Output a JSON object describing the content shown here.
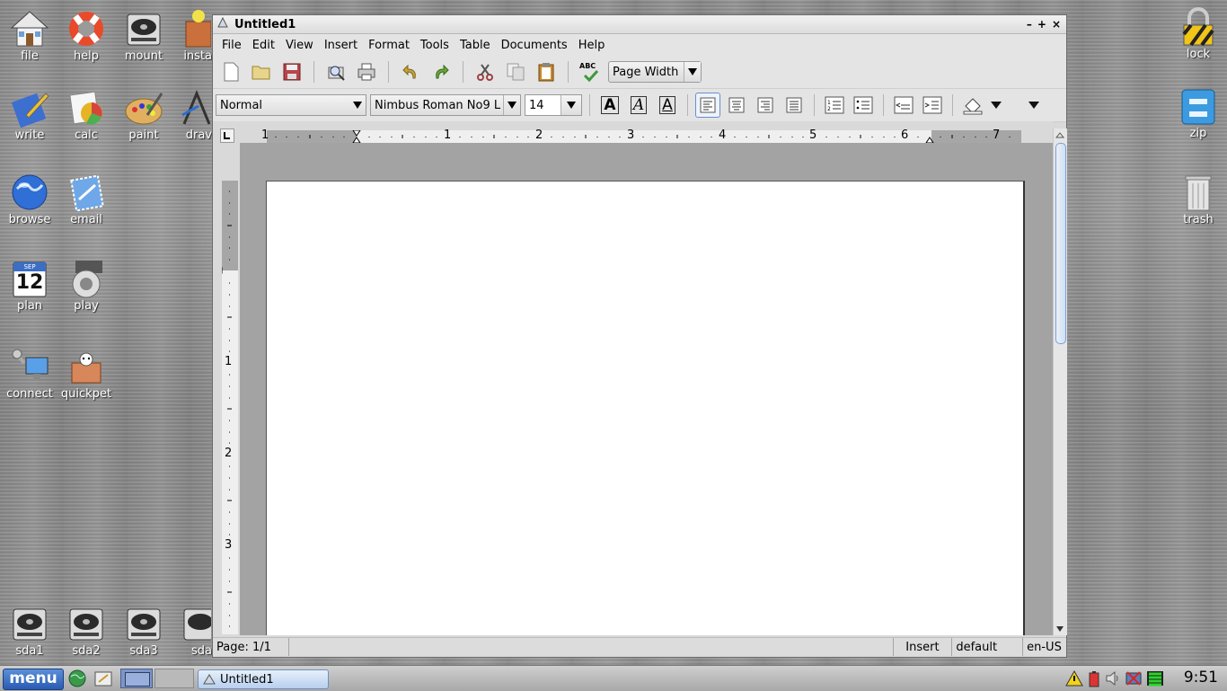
{
  "desktop_icons": {
    "file": "file",
    "help": "help",
    "mount": "mount",
    "install": "insta",
    "write": "write",
    "calc": "calc",
    "paint": "paint",
    "draw": "drav",
    "browse": "browse",
    "email": "email",
    "plan": "plan",
    "plan_date": "12",
    "plan_month": "SEP",
    "play": "play",
    "connect": "connect",
    "quickpet": "quickpet",
    "sda1": "sda1",
    "sda2": "sda2",
    "sda3": "sda3",
    "sda4": "sda",
    "lock": "lock",
    "zip": "zip",
    "trash": "trash"
  },
  "window": {
    "title": "Untitled1",
    "controls": {
      "minimize": "–",
      "maximize": "+",
      "close": "×"
    }
  },
  "menu": [
    "File",
    "Edit",
    "View",
    "Insert",
    "Format",
    "Tools",
    "Table",
    "Documents",
    "Help"
  ],
  "toolbar": {
    "zoom": "Page Width",
    "spell_label": "ABC"
  },
  "format_bar": {
    "style": "Normal",
    "font": "Nimbus Roman No9 L",
    "size": "14",
    "bold": "A",
    "italic": "A",
    "underline": "A"
  },
  "ruler": {
    "h_numbers": [
      "1",
      "1",
      "2",
      "3",
      "4",
      "5",
      "6",
      "7"
    ],
    "v_numbers": [
      "1",
      "2",
      "3"
    ]
  },
  "status": {
    "page": "Page: 1/1",
    "mode": "Insert",
    "style": "default",
    "lang": "en-US"
  },
  "taskbar": {
    "menu": "menu",
    "task": "Untitled1",
    "clock": "9:51"
  },
  "colors": {
    "accent": "#2a5bb3",
    "selection_border": "#6a8fc9"
  }
}
